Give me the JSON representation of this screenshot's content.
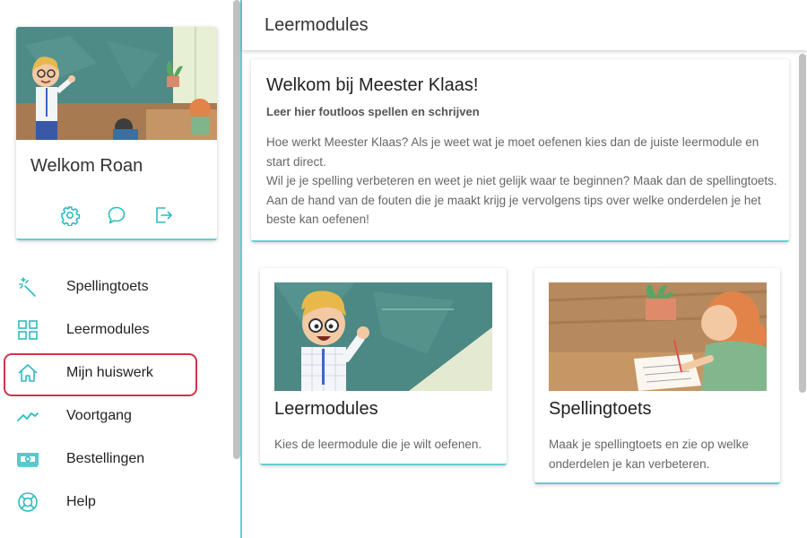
{
  "sidebar": {
    "welcome": "Welkom Roan",
    "profile_actions": [
      {
        "name": "settings",
        "icon": "gear-icon"
      },
      {
        "name": "chat",
        "icon": "chat-bubble-icon"
      },
      {
        "name": "logout",
        "icon": "logout-icon"
      }
    ],
    "nav": [
      {
        "label": "Spellingtoets",
        "icon": "magic-wand-icon",
        "active": false
      },
      {
        "label": "Leermodules",
        "icon": "grid-icon",
        "active": false
      },
      {
        "label": "Mijn huiswerk",
        "icon": "home-icon",
        "active": true
      },
      {
        "label": "Voortgang",
        "icon": "trend-line-icon",
        "active": false
      },
      {
        "label": "Bestellingen",
        "icon": "banknote-icon",
        "active": false
      },
      {
        "label": "Help",
        "icon": "lifebuoy-icon",
        "active": false
      }
    ]
  },
  "main": {
    "page_title": "Leermodules",
    "intro": {
      "title": "Welkom bij Meester Klaas!",
      "subtitle": "Leer hier foutloos spellen en schrijven",
      "paragraph1": "Hoe werkt Meester Klaas? Als je weet wat je moet oefenen kies dan de juiste leermodule en start direct.",
      "paragraph2": "Wil je je spelling verbeteren en weet je niet gelijk waar te beginnen? Maak dan de spellingtoets. Aan de hand van de fouten die je maakt krijg je vervolgens tips over welke onderdelen je het beste kan oefenen!"
    },
    "cards": [
      {
        "title": "Leermodules",
        "description": "Kies de leermodule die je wilt oefenen."
      },
      {
        "title": "Spellingtoets",
        "description": "Maak je spellingtoets en zie op welke onderdelen je kan verbeteren."
      }
    ]
  },
  "colors": {
    "accent": "#2cbcc0",
    "active_outline": "#d0344a",
    "card_border": "#62cfd0",
    "chalkboard": "#4e8a86"
  }
}
